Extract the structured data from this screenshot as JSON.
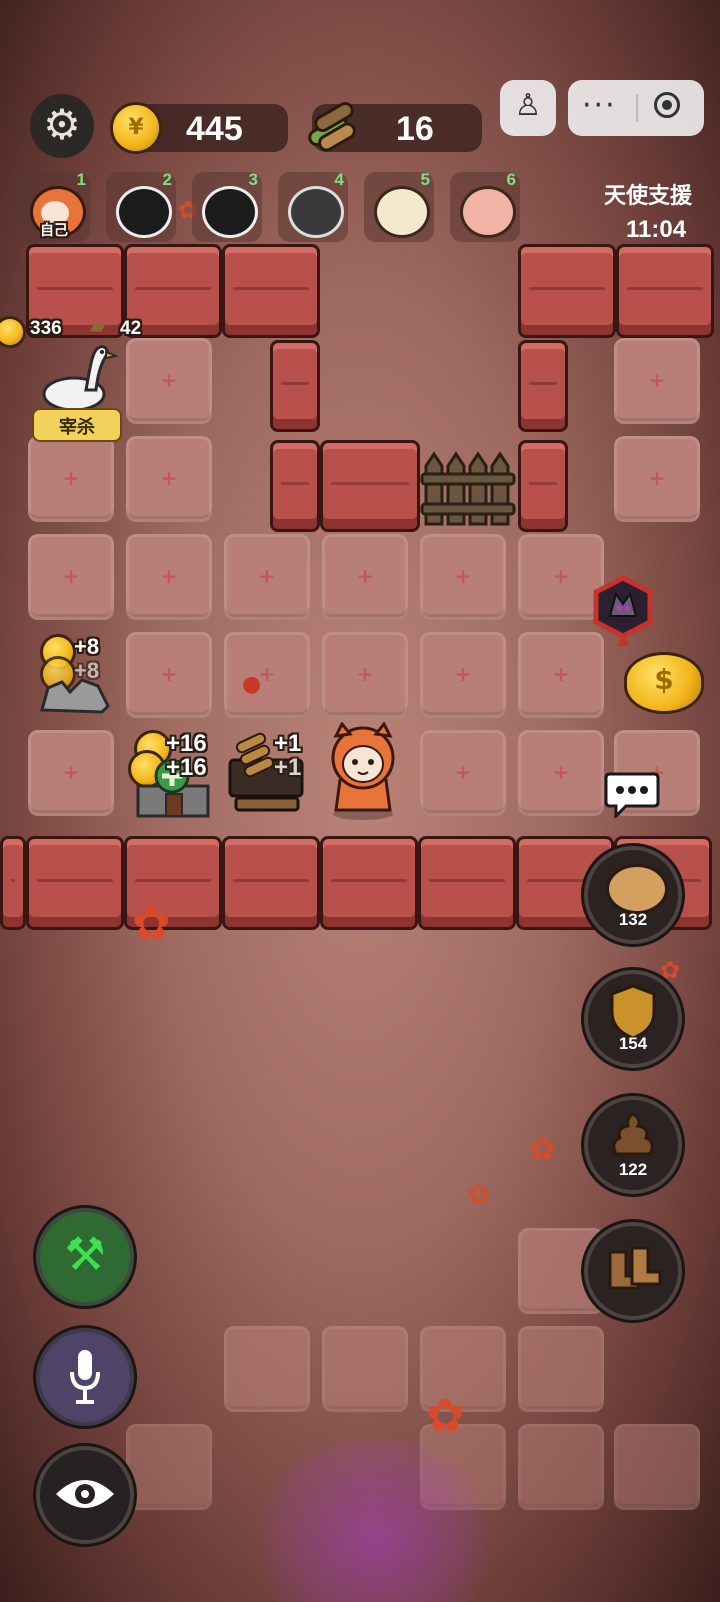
{
  "hud": {
    "coins": "445",
    "wood": "16"
  },
  "players": [
    {
      "num": "1",
      "label": "自己",
      "type": "fox-sheep"
    },
    {
      "num": "2",
      "label": "",
      "type": "black-sheep"
    },
    {
      "num": "3",
      "label": "",
      "type": "black-sheep"
    },
    {
      "num": "4",
      "label": "",
      "type": "grey-sheep"
    },
    {
      "num": "5",
      "label": "",
      "type": "white-sheep"
    },
    {
      "num": "6",
      "label": "",
      "type": "pink-sheep"
    }
  ],
  "support": {
    "title": "天使支援",
    "timer": "11:04"
  },
  "goose": {
    "coins": "336",
    "wood": "42",
    "button": "宰杀"
  },
  "rock_bonus": {
    "line1": "+8",
    "line2": "+8"
  },
  "house_bonus": {
    "line1": "+16",
    "line2": "+16"
  },
  "woodpile_bonus": {
    "line1": "+1",
    "line2": "+1"
  },
  "side_buttons": [
    {
      "icon": "piggy-bank-icon",
      "count": "132"
    },
    {
      "icon": "shield-icon",
      "count": "154"
    },
    {
      "icon": "poop-icon",
      "count": "122"
    },
    {
      "icon": "boots-icon",
      "count": ""
    }
  ],
  "colors": {
    "accent_green": "#4fb84a",
    "coin_gold": "#f2b51a",
    "wall_red": "#b8514b"
  }
}
